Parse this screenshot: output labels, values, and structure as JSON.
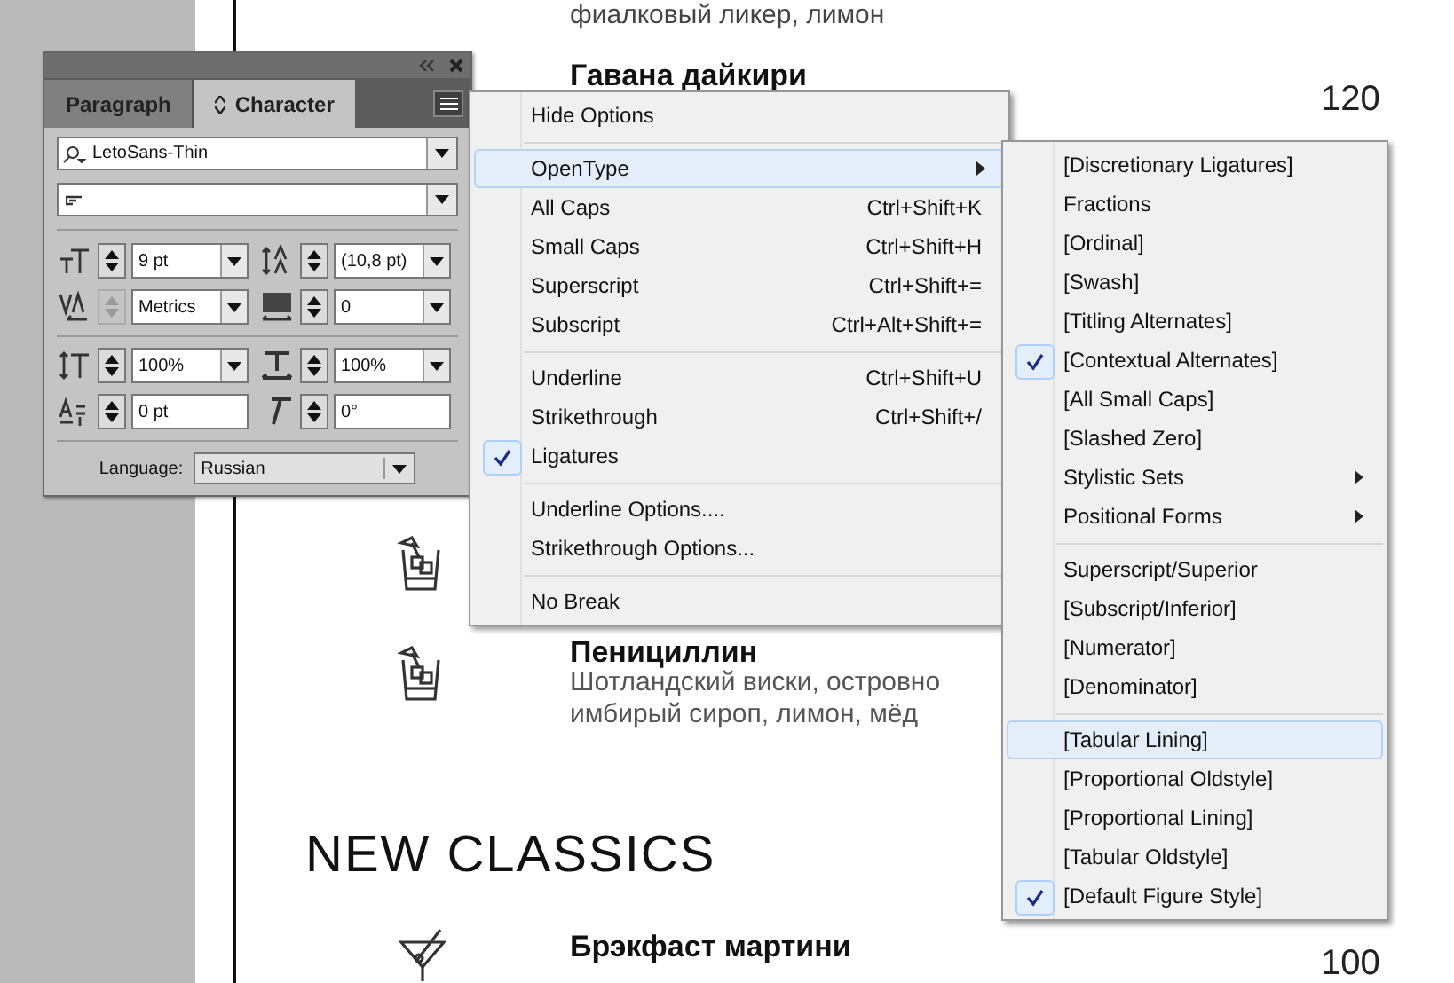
{
  "document": {
    "items": [
      {
        "kind": "description",
        "text": "фиалковый ликер, лимон"
      },
      {
        "kind": "dish",
        "name": "Гавана дайкири",
        "price": "120"
      },
      {
        "kind": "tumbler"
      },
      {
        "kind": "tumbler-dish",
        "name": "Пенициллин",
        "description": [
          "Шотландский виски, островно",
          "имбирый сироп, лимон, мёд"
        ]
      },
      {
        "kind": "heading",
        "text": "NEW CLASSICS"
      },
      {
        "kind": "martini-dish",
        "name": "Брэкфаст мартини",
        "price": "100"
      }
    ]
  },
  "character_panel": {
    "tabs": [
      {
        "label": "Paragraph",
        "selected": false
      },
      {
        "label": "Character",
        "selected": true
      }
    ],
    "font_family": "LetoSans-Thin",
    "fields": [
      {
        "kind": "dropdown",
        "value": "9 pt",
        "stepper_disabled": false
      },
      {
        "kind": "dropdown",
        "value": "(10,8 pt)",
        "stepper_disabled": false
      },
      {
        "kind": "dropdown",
        "value": "Metrics",
        "stepper_disabled": true
      },
      {
        "kind": "dropdown",
        "value": "0",
        "stepper_disabled": false
      },
      {
        "kind": "dropdown",
        "value": "100%",
        "stepper_disabled": false
      },
      {
        "kind": "dropdown",
        "value": "100%",
        "stepper_disabled": false
      },
      {
        "kind": "input",
        "value": "0 pt",
        "stepper_disabled": false
      },
      {
        "kind": "input",
        "value": "0°",
        "stepper_disabled": false
      }
    ],
    "language": {
      "label": "Language:",
      "value": "Russian"
    }
  },
  "options_menu": {
    "items": [
      {
        "kind": "item",
        "label": "Hide Options",
        "checked": false,
        "highlighted": false
      },
      {
        "kind": "separator"
      },
      {
        "kind": "submenu",
        "label": "OpenType",
        "checked": false,
        "highlighted": true
      },
      {
        "kind": "item",
        "label": "All Caps",
        "shortcut": "Ctrl+Shift+K",
        "checked": false,
        "highlighted": false
      },
      {
        "kind": "item",
        "label": "Small Caps",
        "shortcut": "Ctrl+Shift+H",
        "checked": false,
        "highlighted": false
      },
      {
        "kind": "item",
        "label": "Superscript",
        "shortcut": "Ctrl+Shift+=",
        "checked": false,
        "highlighted": false
      },
      {
        "kind": "item",
        "label": "Subscript",
        "shortcut": "Ctrl+Alt+Shift+=",
        "checked": false,
        "highlighted": false
      },
      {
        "kind": "separator"
      },
      {
        "kind": "item",
        "label": "Underline",
        "shortcut": "Ctrl+Shift+U",
        "checked": false,
        "highlighted": false
      },
      {
        "kind": "item",
        "label": "Strikethrough",
        "shortcut": "Ctrl+Shift+/",
        "checked": false,
        "highlighted": false
      },
      {
        "kind": "item",
        "label": "Ligatures",
        "checked": true,
        "highlighted": false
      },
      {
        "kind": "separator"
      },
      {
        "kind": "item",
        "label": "Underline Options....",
        "checked": false,
        "highlighted": false
      },
      {
        "kind": "item",
        "label": "Strikethrough Options...",
        "checked": false,
        "highlighted": false
      },
      {
        "kind": "separator"
      },
      {
        "kind": "item",
        "label": "No Break",
        "checked": false,
        "highlighted": false
      }
    ]
  },
  "opentype_menu": {
    "items": [
      {
        "kind": "item",
        "label": "[Discretionary Ligatures]",
        "checked": false,
        "highlighted": false
      },
      {
        "kind": "item",
        "label": "Fractions",
        "checked": false,
        "highlighted": false
      },
      {
        "kind": "item",
        "label": "[Ordinal]",
        "checked": false,
        "highlighted": false
      },
      {
        "kind": "item",
        "label": "[Swash]",
        "checked": false,
        "highlighted": false
      },
      {
        "kind": "item",
        "label": "[Titling Alternates]",
        "checked": false,
        "highlighted": false
      },
      {
        "kind": "item",
        "label": "[Contextual Alternates]",
        "checked": true,
        "highlighted": false
      },
      {
        "kind": "item",
        "label": "[All Small Caps]",
        "checked": false,
        "highlighted": false
      },
      {
        "kind": "item",
        "label": "[Slashed Zero]",
        "checked": false,
        "highlighted": false
      },
      {
        "kind": "submenu",
        "label": "Stylistic Sets",
        "checked": false,
        "highlighted": false
      },
      {
        "kind": "submenu",
        "label": "Positional Forms",
        "checked": false,
        "highlighted": false
      },
      {
        "kind": "separator"
      },
      {
        "kind": "item",
        "label": "Superscript/Superior",
        "checked": false,
        "highlighted": false
      },
      {
        "kind": "item",
        "label": "[Subscript/Inferior]",
        "checked": false,
        "highlighted": false
      },
      {
        "kind": "item",
        "label": "[Numerator]",
        "checked": false,
        "highlighted": false
      },
      {
        "kind": "item",
        "label": "[Denominator]",
        "checked": false,
        "highlighted": false
      },
      {
        "kind": "separator"
      },
      {
        "kind": "item",
        "label": "[Tabular Lining]",
        "checked": false,
        "highlighted": true
      },
      {
        "kind": "item",
        "label": "[Proportional Oldstyle]",
        "checked": false,
        "highlighted": false
      },
      {
        "kind": "item",
        "label": "[Proportional Lining]",
        "checked": false,
        "highlighted": false
      },
      {
        "kind": "item",
        "label": "[Tabular Oldstyle]",
        "checked": false,
        "highlighted": false
      },
      {
        "kind": "item",
        "label": "[Default Figure Style]",
        "checked": true,
        "highlighted": false
      }
    ]
  }
}
